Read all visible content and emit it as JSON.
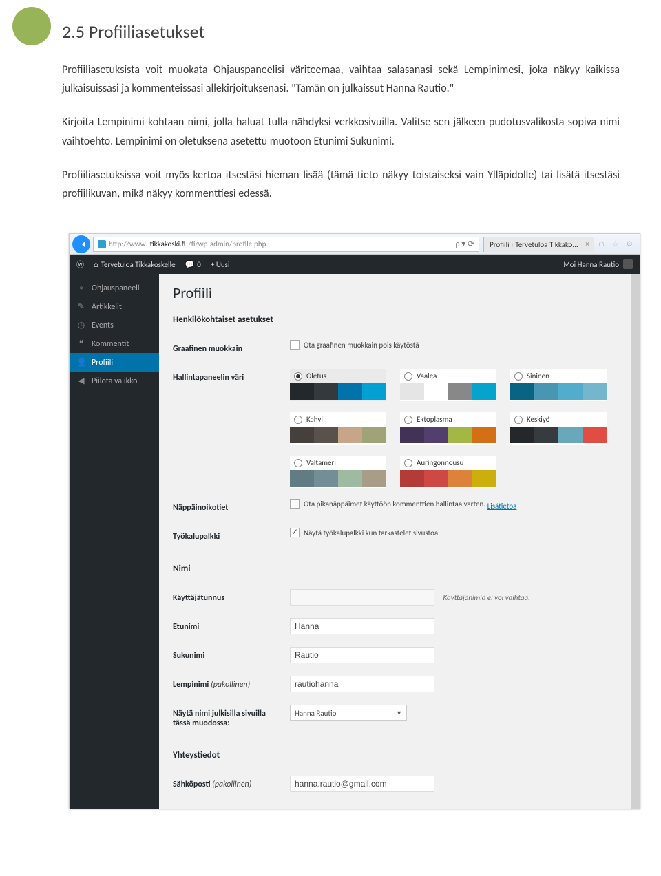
{
  "doc": {
    "heading": "2.5 Profiiliasetukset",
    "p1": "Profiiliasetuksista voit muokata Ohjauspaneelisi väriteemaa, vaihtaa salasanasi sekä Lempinimesi, joka näkyy kaikissa julkaisuissasi ja kommenteissasi allekirjoituksenasi. \"Tämän on julkaissut Hanna Rautio.\"",
    "p2": "Kirjoita Lempinimi kohtaan nimi, jolla haluat tulla nähdyksi verkkosivuilla. Valitse sen jälkeen pudotusvalikosta sopiva nimi vaihtoehto. Lempinimi on oletuksena asetettu muotoon Etunimi Sukunimi.",
    "p3": "Profiiliasetuksissa voit myös kertoa itsestäsi hieman lisää (tämä tieto näkyy toistaiseksi vain Ylläpidolle) tai lisätä itsestäsi profiilikuvan, mikä näkyy kommenttiesi edessä."
  },
  "ie": {
    "url_prefix": "http://www.",
    "url_domain": "tikkakoski.fi",
    "url_path": "/fi/wp-admin/profile.php",
    "search_hint": "ρ ▾  ⟳",
    "tab_title": "Profiili ‹ Tervetuloa Tikkako..."
  },
  "wp_bar": {
    "site_name": "Tervetuloa Tikkakoskelle",
    "comments": "0",
    "new": "+ Uusi",
    "greeting": "Moi Hanna Rautio"
  },
  "side": {
    "items": [
      {
        "icon": "⌖",
        "label": "Ohjauspaneeli",
        "name": "sidebar-dashboard"
      },
      {
        "icon": "✎",
        "label": "Artikkelit",
        "name": "sidebar-posts"
      },
      {
        "icon": "◷",
        "label": "Events",
        "name": "sidebar-events"
      },
      {
        "icon": "❝",
        "label": "Kommentit",
        "name": "sidebar-comments"
      },
      {
        "icon": "👤",
        "label": "Profiili",
        "name": "sidebar-profile",
        "active": true
      },
      {
        "icon": "◀",
        "label": "Piilota valikko",
        "name": "sidebar-collapse"
      }
    ]
  },
  "profile": {
    "page_title": "Profiili",
    "section_personal": "Henkilökohtaiset asetukset",
    "row_editor": "Graafinen muokkain",
    "editor_cb": "Ota graafinen muokkain pois käytöstä",
    "row_scheme": "Hallintapaneelin väri",
    "schemes": [
      {
        "name": "Oletus",
        "selected": true,
        "colors": [
          "#23282d",
          "#34393e",
          "#0073aa",
          "#00a0d2"
        ]
      },
      {
        "name": "Vaalea",
        "selected": false,
        "colors": [
          "#e5e5e5",
          "#ffffff",
          "#888888",
          "#04a4cc"
        ]
      },
      {
        "name": "Sininen",
        "selected": false,
        "colors": [
          "#096484",
          "#4796b3",
          "#52accc",
          "#74b6ce"
        ]
      },
      {
        "name": "Kahvi",
        "selected": false,
        "colors": [
          "#46403c",
          "#59524c",
          "#c7a589",
          "#9ea476"
        ]
      },
      {
        "name": "Ektoplasma",
        "selected": false,
        "colors": [
          "#413256",
          "#523f6d",
          "#a3b745",
          "#d46f15"
        ]
      },
      {
        "name": "Keskiyö",
        "selected": false,
        "colors": [
          "#25282b",
          "#363b3f",
          "#69a8bb",
          "#e14d43"
        ]
      },
      {
        "name": "Valtameri",
        "selected": false,
        "colors": [
          "#627c83",
          "#738e96",
          "#9ebaa0",
          "#aa9d88"
        ]
      },
      {
        "name": "Auringonnousu",
        "selected": false,
        "colors": [
          "#b43c38",
          "#cf4944",
          "#dd823b",
          "#ccaf0b"
        ]
      }
    ],
    "row_shortcuts": "Näppäinoikotiet",
    "shortcuts_cb": "Ota pikanäppäimet käyttöön kommenttien hallintaa varten.",
    "shortcuts_link": "Lisätietoa",
    "row_toolbar": "Työkalupalkki",
    "toolbar_cb": "Näytä työkalupalkki kun tarkastelet sivustoa",
    "section_name": "Nimi",
    "row_user": "Käyttäjätunnus",
    "user_hint": "Käyttäjänimiä ei voi vaihtaa.",
    "row_first": "Etunimi",
    "first_val": "Hanna",
    "row_last": "Sukunimi",
    "last_val": "Rautio",
    "row_nick": "Lempinimi",
    "nick_req": "(pakollinen)",
    "nick_val": "rautiohanna",
    "row_display": "Näytä nimi julkisilla sivuilla tässä muodossa:",
    "display_val": "Hanna Rautio",
    "section_contact": "Yhteystiedot",
    "row_email": "Sähköposti",
    "email_req": "(pakollinen)",
    "email_val": "hanna.rautio@gmail.com"
  }
}
